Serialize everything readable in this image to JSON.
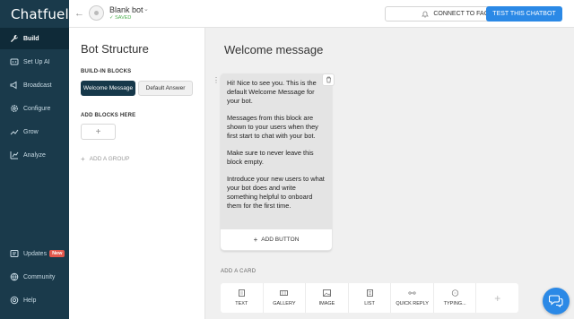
{
  "app": {
    "logo": "Chatfuel"
  },
  "sidebar": {
    "items": [
      {
        "label": "Build",
        "icon": "wrench-icon",
        "active": true
      },
      {
        "label": "Set Up AI",
        "icon": "ai-icon"
      },
      {
        "label": "Broadcast",
        "icon": "broadcast-icon"
      },
      {
        "label": "Configure",
        "icon": "gear-icon"
      },
      {
        "label": "Grow",
        "icon": "chart-up-icon"
      },
      {
        "label": "Analyze",
        "icon": "analytics-icon"
      }
    ],
    "bottom": [
      {
        "label": "Updates",
        "icon": "updates-icon",
        "badge": "New"
      },
      {
        "label": "Community",
        "icon": "community-icon"
      },
      {
        "label": "Help",
        "icon": "help-icon"
      }
    ]
  },
  "topbar": {
    "bot_name": "Blank bot",
    "saved": "✓ SAVED",
    "connect_label": "CONNECT TO FACEBOOK",
    "test_label": "TEST THIS CHATBOT"
  },
  "structure": {
    "title": "Bot Structure",
    "builtin_label": "BUILD-IN BLOCKS",
    "blocks": [
      "Welcome Message",
      "Default Answer"
    ],
    "add_blocks_label": "ADD BLOCKS HERE",
    "add_group_label": "ADD A GROUP"
  },
  "main": {
    "title": "Welcome message",
    "message_paragraphs": [
      "Hi! Nice to see you. This is the default Welcome Message for your bot.",
      "Messages from this block are shown to your users when they first start to chat with your bot.",
      "Make sure to never leave this block empty.",
      "Introduce your new users to what your bot does and write something helpful to onboard them for the first time."
    ],
    "add_button_label": "ADD BUTTON",
    "add_card_label": "ADD A CARD",
    "card_types": [
      "TEXT",
      "GALLERY",
      "IMAGE",
      "LIST",
      "QUICK REPLY",
      "TYPING..."
    ]
  },
  "colors": {
    "sidebar": "#1a3a4b",
    "accent": "#2b89e6",
    "saved": "#4caf50",
    "badge": "#e2574c"
  }
}
